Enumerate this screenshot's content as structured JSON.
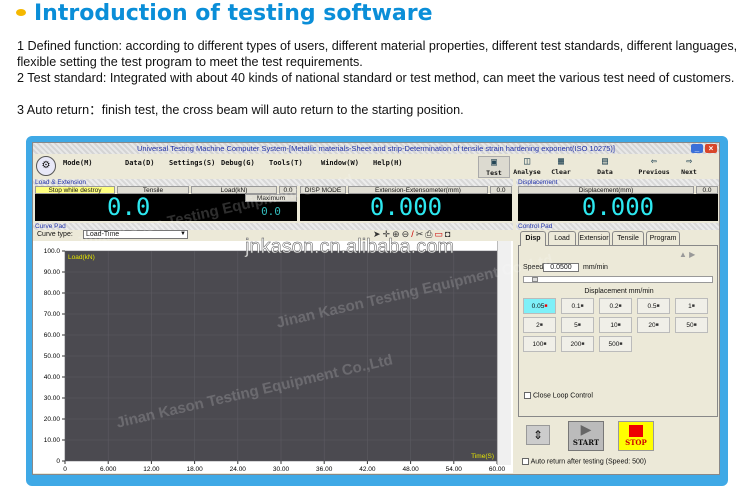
{
  "heading": "Introduction of testing software",
  "paragraphs": [
    "1 Defined function: according to different types of users, different material properties, different test standards, different languages, flexible setting the test program to meet the test requirements.",
    "2 Test standard: Integrated with about 40 kinds of national standard or test method, can meet the various test need of customers.",
    "3 Auto return：finish test, the cross beam will auto return to the starting position."
  ],
  "window": {
    "title": "Universal Testing Machine Computer System-[Metallic materials-Sheet and strip-Determination of tensile strain hardening exponent(ISO 10275)]",
    "menu": [
      "Mode(M)",
      "Data(D)",
      "Settings(S)",
      "Debug(G)",
      "Tools(T)",
      "Window(W)",
      "Help(H)"
    ],
    "toolbar": [
      {
        "label": "Test",
        "icon": "monitor-icon"
      },
      {
        "label": "Analyse",
        "icon": "analyse-icon"
      },
      {
        "label": "Clear",
        "icon": "grid-icon"
      },
      {
        "label": "Data",
        "icon": "database-icon"
      },
      {
        "label": "Previous",
        "icon": "arrow-left-icon"
      },
      {
        "label": "Next",
        "icon": "arrow-right-icon"
      }
    ]
  },
  "load_ext": {
    "section": "Load & Extension",
    "mode_label": "Stop while destroy",
    "test_type": "Tensile",
    "load_label": "Load(kN)",
    "load_small": "0.0",
    "load_value": "0.0",
    "maximum_label": "Maximum",
    "maximum_value": "0.0",
    "disp_mode": "DISP MODE",
    "ext_label": "Extension-Extensometer(mm)",
    "ext_small": "0.0",
    "ext_value": "0.000"
  },
  "displacement": {
    "section": "Displacement",
    "label": "Displacement(mm)",
    "small": "0.0",
    "value": "0.000"
  },
  "curve_pad": {
    "section": "Curve Pad",
    "curve_type_label": "Curve type:",
    "curve_type": "Load-Time"
  },
  "chart_data": {
    "type": "line",
    "ylabel": "Load(kN)",
    "xlabel": "Time(S)",
    "xlim": [
      0,
      60
    ],
    "ylim": [
      0,
      100
    ],
    "x_ticks": [
      "0",
      "6.000",
      "12.00",
      "18.00",
      "24.00",
      "30.00",
      "36.00",
      "42.00",
      "48.00",
      "54.00",
      "60.00"
    ],
    "y_ticks": [
      "0",
      "10.00",
      "20.00",
      "30.00",
      "40.00",
      "50.00",
      "60.00",
      "70.00",
      "80.00",
      "90.00",
      "100.0"
    ],
    "grid": true,
    "series": [],
    "background": "#4b4a50",
    "label_color": "#e6e600"
  },
  "watermarks": [
    "jnkason.cn.alibaba.com",
    "Jinan Kason Testing Equipment Co.,Ltd"
  ],
  "control_pad": {
    "section": "Control Pad",
    "tabs": [
      "Disp",
      "Load",
      "Extensior",
      "Tensile",
      "Program"
    ],
    "speed_label": "Speed",
    "speed_value": "0.0500",
    "speed_unit": "mm/min",
    "group_label": "Displacement mm/min",
    "speeds": [
      "0.05",
      "0.1",
      "0.2",
      "0.5",
      "1",
      "2",
      "5",
      "10",
      "20",
      "50",
      "100",
      "200",
      "500"
    ],
    "selected_speed": "0.05",
    "close_loop": "Close Loop Control",
    "start": "START",
    "stop": "STOP",
    "auto_return": "Auto return after testing (Speed: 500)"
  }
}
